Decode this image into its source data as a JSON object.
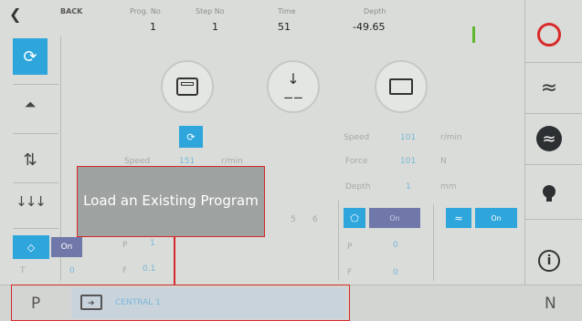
{
  "header": {
    "back_label": "BACK",
    "prog_no_label": "Prog. No",
    "prog_no_value": "1",
    "step_no_label": "Step No",
    "step_no_value": "1",
    "time_label": "Time",
    "time_value": "51",
    "depth_label": "Depth",
    "depth_value": "-49.65",
    "status_indicator_color": "#5fb82f"
  },
  "left_panel": {
    "speed_label": "Speed",
    "speed_value": "151",
    "speed_unit": "r/min",
    "p_label": "P",
    "p_value": "1",
    "f_label": "F",
    "f_value": "0.1",
    "t_label": "T",
    "t_value": "0",
    "on_label": "On",
    "step_a": "5",
    "step_b": "6"
  },
  "right_panel": {
    "speed_label": "Speed",
    "speed_value": "101",
    "speed_unit": "r/min",
    "force_label": "Force",
    "force_value": "101",
    "force_unit": "N",
    "depth_label": "Depth",
    "depth_value": "1",
    "depth_unit": "mm",
    "toggle1_label": "On",
    "toggle2_label": "On",
    "p_label": "P",
    "p_value": "0",
    "f_label": "F",
    "f_value": "0"
  },
  "footer": {
    "p_label": "P",
    "program_name": "CENTRAL 1",
    "n_label": "N"
  },
  "overlay": {
    "text": "Load an Existing Program"
  },
  "colors": {
    "accent_blue": "#2ea6dc",
    "highlight_red": "#d62828",
    "panel_bg": "#d9dcd8",
    "overlay_bg": "#9ea2a0"
  }
}
